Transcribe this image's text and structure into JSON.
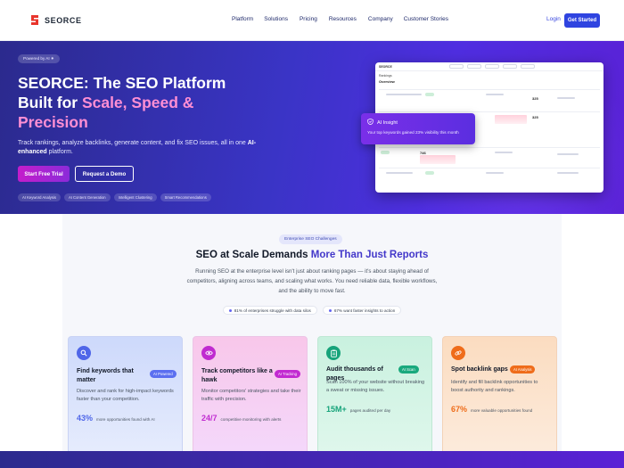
{
  "nav": {
    "logo_text": "SEORCE",
    "links": [
      "Platform",
      "Solutions",
      "Pricing",
      "Resources",
      "Company",
      "Customer Stories"
    ],
    "login": "Login",
    "cta": "Get Started"
  },
  "hero": {
    "powered": "Powered by AI ✷",
    "title_prefix": "SEORCE: The SEO Platform Built for ",
    "title_accent": "Scale, Speed & Precision",
    "subtitle_1": "Track rankings, analyze backlinks, generate content, and fix SEO issues, all in one ",
    "subtitle_bold": "AI-enhanced",
    "subtitle_2": " platform.",
    "btn_trial": "Start Free Trial",
    "btn_demo": "Request a Demo",
    "chips": [
      "AI Keyword Analysis",
      "AI Content Generation",
      "Intelligent Clustering",
      "Smart Recommendations"
    ]
  },
  "dashboard": {
    "logo": "SEORCE",
    "breadcrumb": "Rankings",
    "overview": "Overview",
    "rows": [
      {
        "value": "746"
      },
      {
        "value": "325"
      },
      {
        "value": "746"
      },
      {
        "value": "325"
      }
    ]
  },
  "insight": {
    "title": "AI Insight",
    "text": "Your top keywords gained 23% visibility this month"
  },
  "section": {
    "pill": "Enterprise SEO Challenges",
    "title_prefix": "SEO at Scale Demands ",
    "title_accent": "More Than Just Reports",
    "subtitle": "Running SEO at the enterprise level isn't just about ranking pages — it's about staying ahead of competitors, aligning across teams, and scaling what works. You need reliable data, flexible workflows, and the ability to move fast.",
    "stats": [
      "81% of enterprises struggle with data silos",
      "67% want faster insights to action"
    ]
  },
  "cards": [
    {
      "title": "Find keywords that matter",
      "badge": "AI Powered",
      "desc": "Discover and rank for high-impact keywords faster than your competition.",
      "stat": "43%",
      "stat_label": "more opportunities found with AI",
      "icon": "search-icon"
    },
    {
      "title": "Track competitors like a hawk",
      "badge": "AI Tracking",
      "desc": "Monitor competitors' strategies and take their traffic with precision.",
      "stat": "24/7",
      "stat_label": "competitive monitoring with alerts",
      "icon": "eye-icon"
    },
    {
      "title": "Audit thousands of pages",
      "badge": "AI Scan",
      "desc": "Scan 100% of your website without breaking a sweat or missing issues.",
      "stat": "15M+",
      "stat_label": "pages audited per day",
      "icon": "clipboard-icon"
    },
    {
      "title": "Spot backlink gaps",
      "badge": "AI Analysis",
      "desc": "Identify and fill backlink opportunities to boost authority and rankings.",
      "stat": "67%",
      "stat_label": "more valuable opportunities found",
      "icon": "link-icon"
    }
  ]
}
